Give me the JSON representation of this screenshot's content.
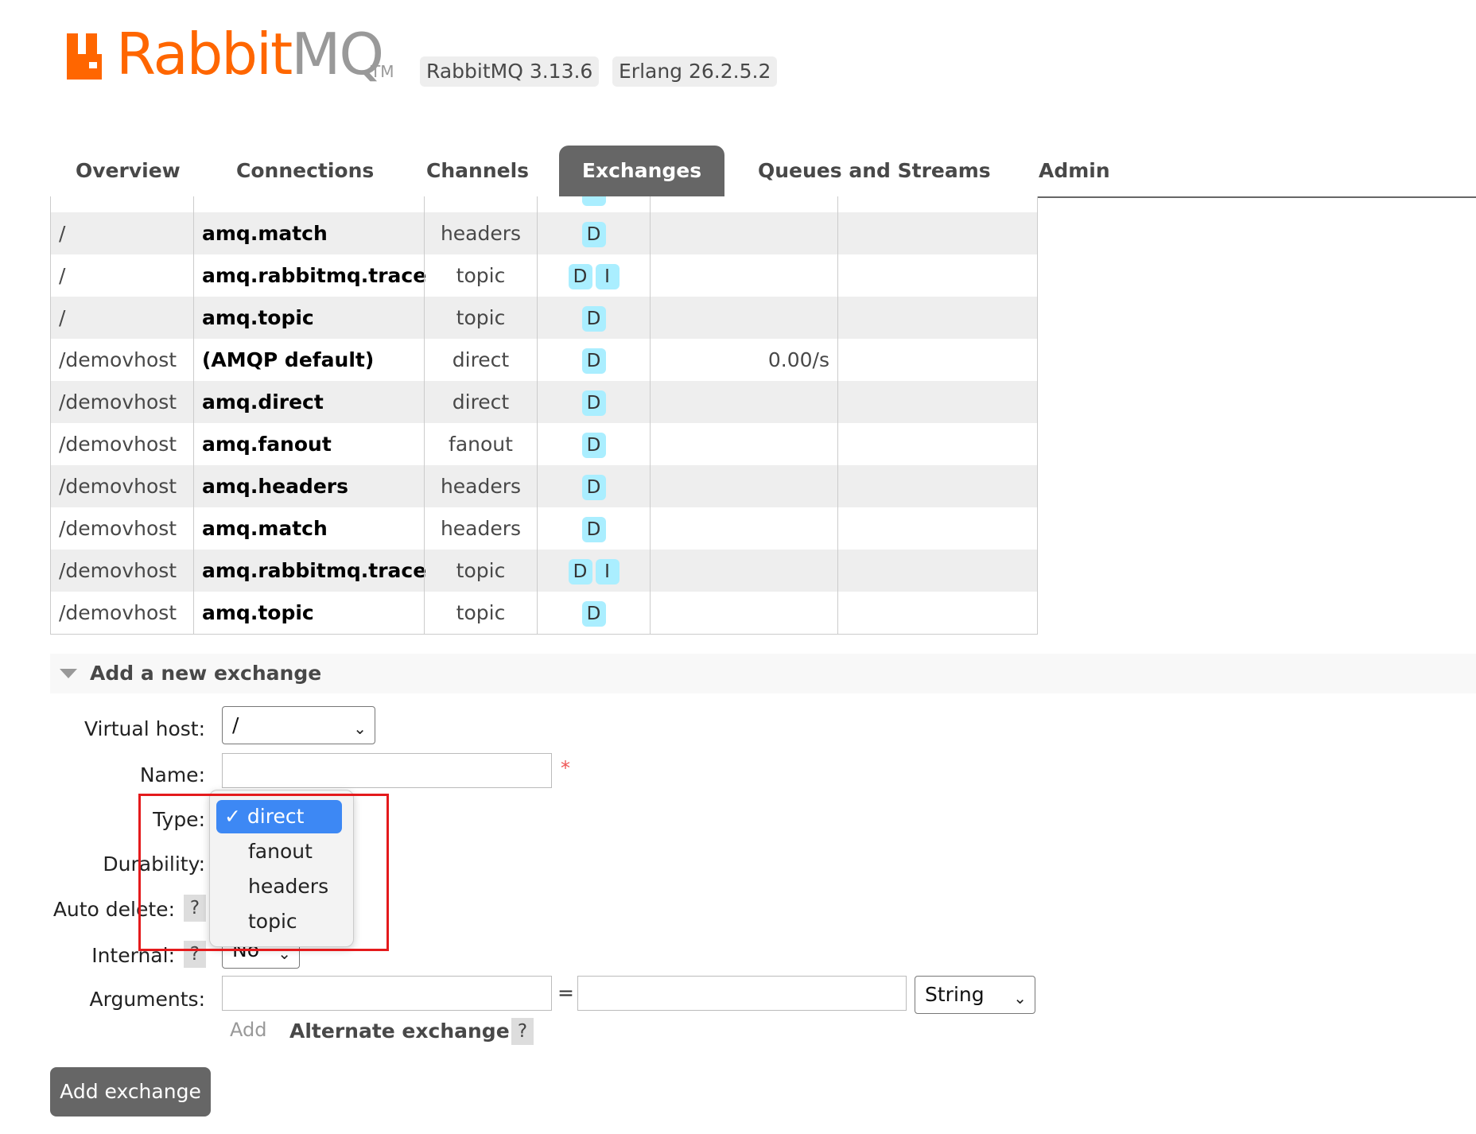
{
  "header": {
    "logo_text_main": "Rabbit",
    "logo_text_mq": "MQ",
    "logo_tm": "TM",
    "rabbitmq_version": "RabbitMQ 3.13.6",
    "erlang_version": "Erlang 26.2.5.2"
  },
  "tabs": [
    {
      "label": "Overview",
      "active": false
    },
    {
      "label": "Connections",
      "active": false
    },
    {
      "label": "Channels",
      "active": false
    },
    {
      "label": "Exchanges",
      "active": true
    },
    {
      "label": "Queues and Streams",
      "active": false
    },
    {
      "label": "Admin",
      "active": false
    }
  ],
  "exchanges": [
    {
      "vhost": "/",
      "name": "amq.match",
      "type": "headers",
      "features": [
        "D"
      ],
      "rate_in": "",
      "rate_out": ""
    },
    {
      "vhost": "/",
      "name": "amq.rabbitmq.trace",
      "type": "topic",
      "features": [
        "D",
        "I"
      ],
      "rate_in": "",
      "rate_out": ""
    },
    {
      "vhost": "/",
      "name": "amq.topic",
      "type": "topic",
      "features": [
        "D"
      ],
      "rate_in": "",
      "rate_out": ""
    },
    {
      "vhost": "/demovhost",
      "name": "(AMQP default)",
      "type": "direct",
      "features": [
        "D"
      ],
      "rate_in": "0.00/s",
      "rate_out": ""
    },
    {
      "vhost": "/demovhost",
      "name": "amq.direct",
      "type": "direct",
      "features": [
        "D"
      ],
      "rate_in": "",
      "rate_out": ""
    },
    {
      "vhost": "/demovhost",
      "name": "amq.fanout",
      "type": "fanout",
      "features": [
        "D"
      ],
      "rate_in": "",
      "rate_out": ""
    },
    {
      "vhost": "/demovhost",
      "name": "amq.headers",
      "type": "headers",
      "features": [
        "D"
      ],
      "rate_in": "",
      "rate_out": ""
    },
    {
      "vhost": "/demovhost",
      "name": "amq.match",
      "type": "headers",
      "features": [
        "D"
      ],
      "rate_in": "",
      "rate_out": ""
    },
    {
      "vhost": "/demovhost",
      "name": "amq.rabbitmq.trace",
      "type": "topic",
      "features": [
        "D",
        "I"
      ],
      "rate_in": "",
      "rate_out": ""
    },
    {
      "vhost": "/demovhost",
      "name": "amq.topic",
      "type": "topic",
      "features": [
        "D"
      ],
      "rate_in": "",
      "rate_out": ""
    }
  ],
  "add_exchange": {
    "section_title": "Add a new exchange",
    "virtual_host_label": "Virtual host:",
    "virtual_host_value": "/",
    "name_label": "Name:",
    "required_mark": "*",
    "type_label": "Type:",
    "type_options": [
      "direct",
      "fanout",
      "headers",
      "topic"
    ],
    "type_selected": "direct",
    "durability_label": "Durability:",
    "auto_delete_label": "Auto delete:",
    "internal_label": "Internal:",
    "internal_value": "No",
    "help_mark": "?",
    "arguments_label": "Arguments:",
    "equals": "=",
    "arg_type_value": "String",
    "add_link": "Add",
    "alternate_exchange": "Alternate exchange",
    "submit_button": "Add exchange"
  }
}
